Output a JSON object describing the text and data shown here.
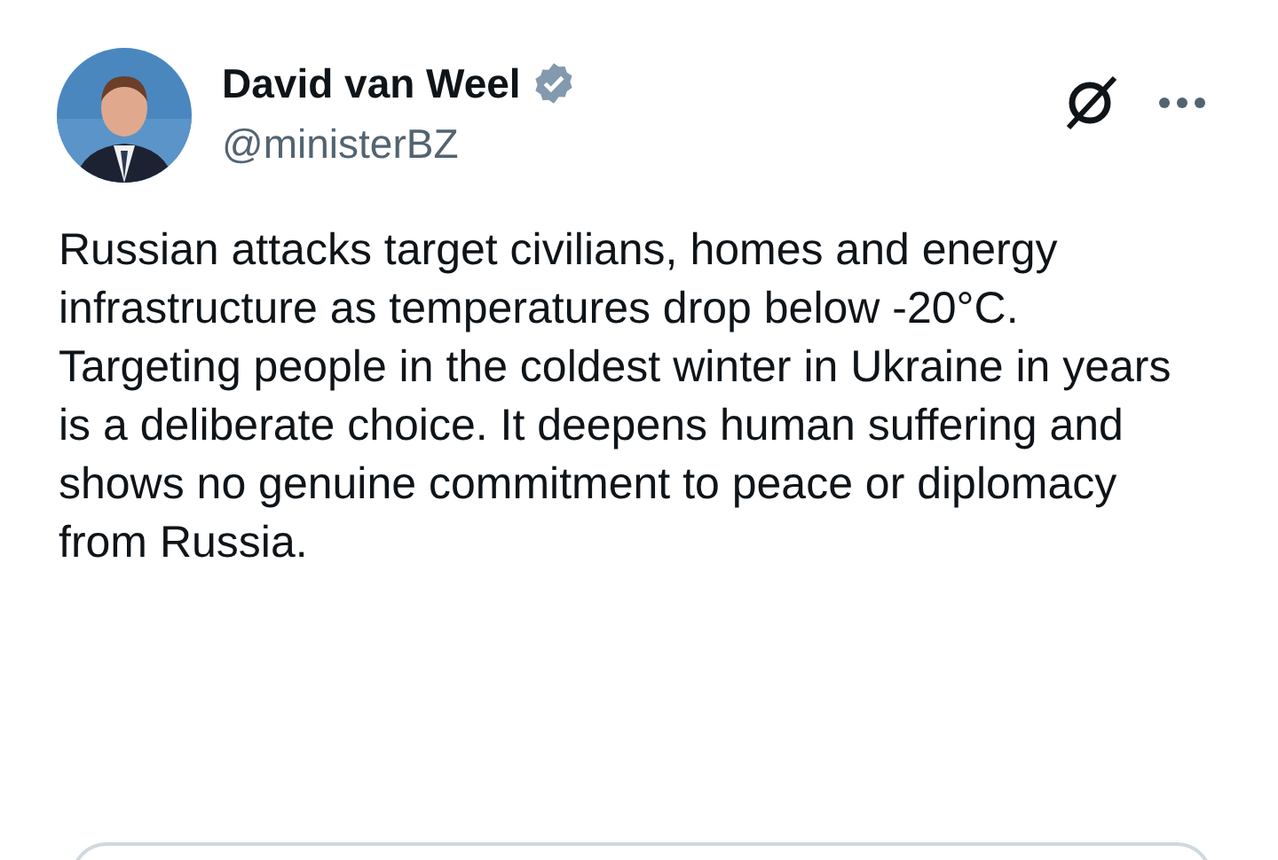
{
  "author": {
    "name": "David van Weel",
    "verified": true,
    "handle": "@ministerBZ"
  },
  "body": "Russian attacks target civilians, homes and energy infrastructure as temperatures drop below -20°C. Targeting people in the coldest winter in Ukraine in years is a deliberate choice. It deepens human suffering and shows no genuine commitment to peace or diplomacy from Russia.",
  "embed": {
    "kind": "card"
  }
}
